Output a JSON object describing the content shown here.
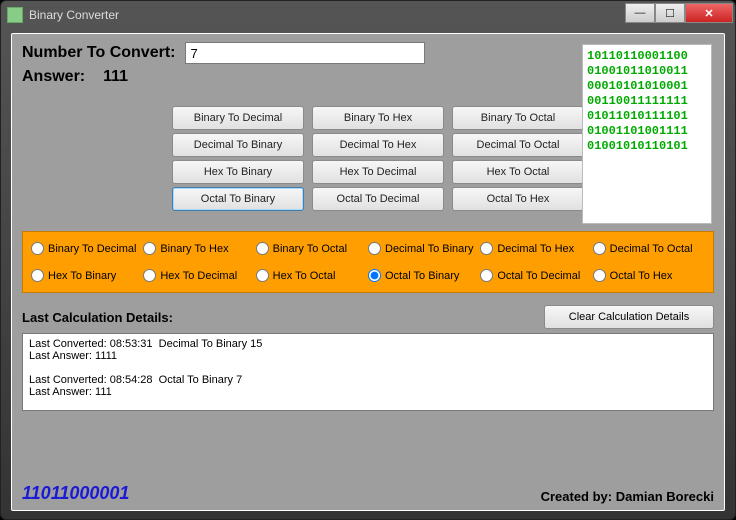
{
  "window": {
    "title": "Binary Converter"
  },
  "inputs": {
    "number_label": "Number To Convert:",
    "number_value": "7",
    "answer_label": "Answer:",
    "answer_value": "111"
  },
  "buttons": {
    "grid": [
      "Binary To Decimal",
      "Binary To Hex",
      "Binary To Octal",
      "Decimal To Binary",
      "Decimal To Hex",
      "Decimal To Octal",
      "Hex To Binary",
      "Hex To Decimal",
      "Hex To Octal",
      "Octal To Binary",
      "Octal To Decimal",
      "Octal To Hex"
    ],
    "active_index": 9,
    "clear": "Clear Calculation Details"
  },
  "radios": {
    "items": [
      "Binary To Decimal",
      "Binary To Hex",
      "Binary To Octal",
      "Decimal To Binary",
      "Decimal To Hex",
      "Decimal To Octal",
      "Hex To Binary",
      "Hex To Decimal",
      "Hex To Octal",
      "Octal To Binary",
      "Octal To Decimal",
      "Octal To Hex"
    ],
    "selected_index": 9
  },
  "details": {
    "label": "Last Calculation Details:",
    "log": "Last Converted: 08:53:31  Decimal To Binary 15\nLast Answer: 1111\n\nLast Converted: 08:54:28  Octal To Binary 7\nLast Answer: 111"
  },
  "decoration": {
    "binary_block": "10110110001100\n01001011010011\n00010101010001\n00110011111111\n01011010111101\n01001101001111\n01001010110101",
    "footer_binary": "11011000001"
  },
  "credit": "Created by: Damian Borecki"
}
